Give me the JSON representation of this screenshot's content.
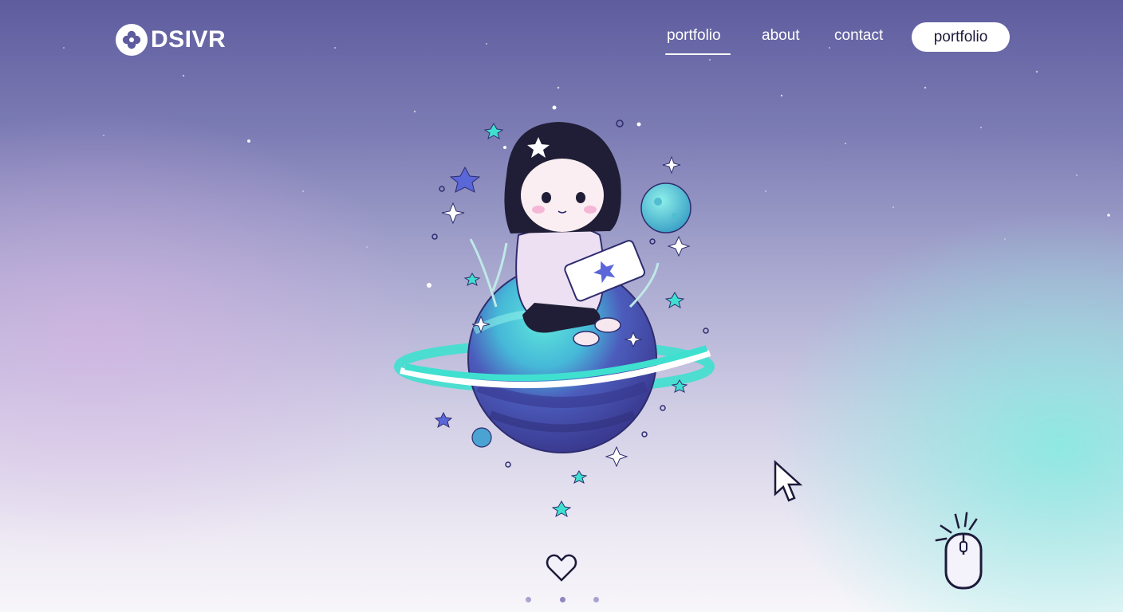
{
  "brand": {
    "name": "DSIVR",
    "logo_icon": "clover-icon"
  },
  "nav": {
    "items": [
      {
        "label": "portfolio",
        "active": true
      },
      {
        "label": "about",
        "active": false
      },
      {
        "label": "contact",
        "active": false
      }
    ],
    "cta_label": "portfolio"
  },
  "hero": {
    "illustration": "girl-on-planet-illustration",
    "decorations": [
      "star-icon",
      "sparkle-icon",
      "moon-icon"
    ]
  },
  "carousel": {
    "count": 3,
    "active_index": 1
  },
  "icons": {
    "cursor": "pointer-cursor-icon",
    "scroll": "mouse-scroll-icon",
    "like": "heart-icon"
  },
  "colors": {
    "accent": "#3fe0cf",
    "planet": "#4a4aa8",
    "text": "#ffffff",
    "cta_text": "#1d1b3a"
  }
}
